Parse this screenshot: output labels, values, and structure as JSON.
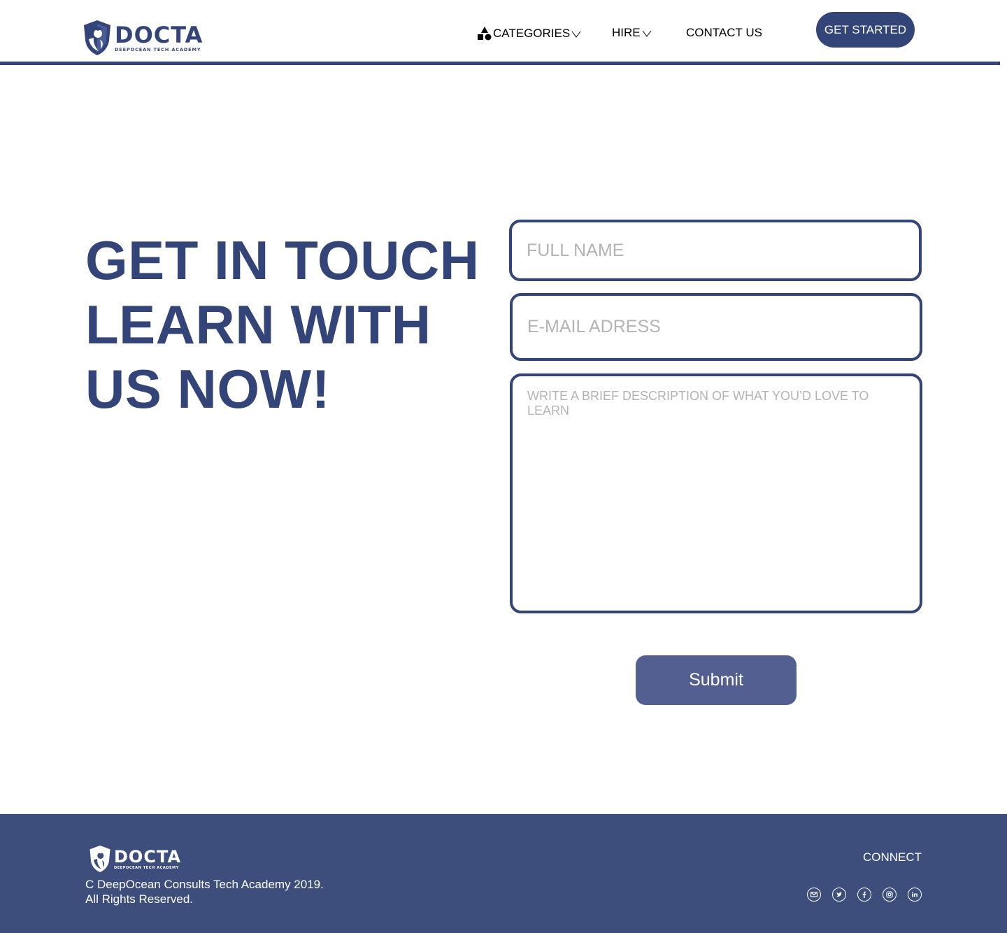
{
  "colors": {
    "brand": "#334479",
    "footer_bg": "#3d4d7c",
    "submit_bg": "#525f90",
    "placeholder": "#b3b3b3"
  },
  "header": {
    "logo": {
      "name": "DOCTA",
      "tagline": "DEEPOCEAN TECH ACADEMY",
      "icon": "shield-graduate-icon"
    },
    "nav": [
      {
        "label": "CATEGORIES",
        "icon": "shapes-icon",
        "dropdown": true
      },
      {
        "label": "HIRE",
        "dropdown": true
      },
      {
        "label": "CONTACT US",
        "dropdown": false
      }
    ],
    "cta": "GET STARTED"
  },
  "hero": {
    "title_lines": [
      "GET IN TOUCH",
      "LEARN WITH",
      "US NOW!"
    ]
  },
  "form": {
    "full_name": {
      "placeholder": "FULL NAME",
      "value": ""
    },
    "email": {
      "placeholder": "E-MAIL ADRESS",
      "value": ""
    },
    "description": {
      "placeholder": "WRITE A BRIEF DESCRIPTION OF WHAT YOU’D LOVE TO LEARN",
      "value": ""
    },
    "submit": "Submit"
  },
  "footer": {
    "logo": {
      "name": "DOCTA",
      "tagline": "DEEPOCEAN TECH ACADEMY"
    },
    "copyright_lines": [
      "C DeepOcean Consults Tech Academy 2019.",
      "All Rights Reserved."
    ],
    "connect": "CONNECT",
    "socials": [
      "mail-icon",
      "twitter-icon",
      "facebook-icon",
      "instagram-icon",
      "linkedin-icon"
    ]
  }
}
